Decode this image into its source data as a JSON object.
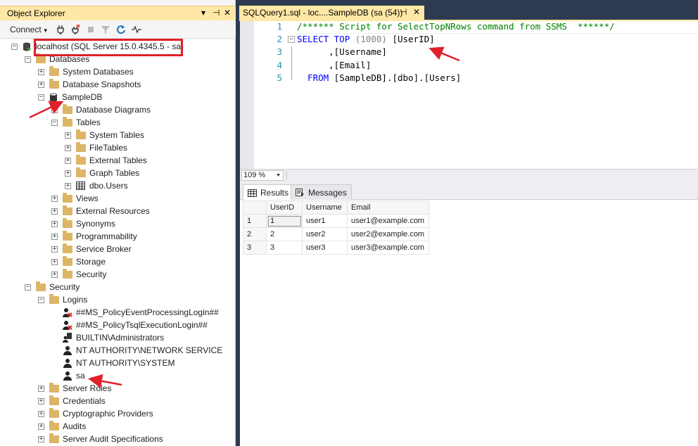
{
  "object_explorer": {
    "title": "Object Explorer",
    "pin": "▾ ‡",
    "close": "✕",
    "connect_label": "Connect",
    "tree": [
      {
        "label": "localhost (SQL Server 15.0.4345.5 - sa)",
        "icon": "server-icon",
        "expander": "−"
      },
      {
        "label": "Databases",
        "icon": "folder-icon",
        "expander": "−"
      },
      {
        "label": "System Databases",
        "icon": "folder-icon",
        "expander": "+"
      },
      {
        "label": "Database Snapshots",
        "icon": "folder-icon",
        "expander": "+"
      },
      {
        "label": "SampleDB",
        "icon": "database-icon",
        "expander": "−"
      },
      {
        "label": "Database Diagrams",
        "icon": "folder-icon",
        "expander": "+"
      },
      {
        "label": "Tables",
        "icon": "folder-icon",
        "expander": "−"
      },
      {
        "label": "System Tables",
        "icon": "folder-icon",
        "expander": "+"
      },
      {
        "label": "FileTables",
        "icon": "folder-icon",
        "expander": "+"
      },
      {
        "label": "External Tables",
        "icon": "folder-icon",
        "expander": "+"
      },
      {
        "label": "Graph Tables",
        "icon": "folder-icon",
        "expander": "+"
      },
      {
        "label": "dbo.Users",
        "icon": "table-icon",
        "expander": "+"
      },
      {
        "label": "Views",
        "icon": "folder-icon",
        "expander": "+"
      },
      {
        "label": "External Resources",
        "icon": "folder-icon",
        "expander": "+"
      },
      {
        "label": "Synonyms",
        "icon": "folder-icon",
        "expander": "+"
      },
      {
        "label": "Programmability",
        "icon": "folder-icon",
        "expander": "+"
      },
      {
        "label": "Service Broker",
        "icon": "folder-icon",
        "expander": "+"
      },
      {
        "label": "Storage",
        "icon": "folder-icon",
        "expander": "+"
      },
      {
        "label": "Security",
        "icon": "folder-icon",
        "expander": "+"
      },
      {
        "label": "Security",
        "icon": "folder-icon",
        "expander": "−"
      },
      {
        "label": "Logins",
        "icon": "folder-icon",
        "expander": "−"
      },
      {
        "label": "##MS_PolicyEventProcessingLogin##",
        "icon": "disabled-login-icon",
        "expander": ""
      },
      {
        "label": "##MS_PolicyTsqlExecutionLogin##",
        "icon": "disabled-login-icon",
        "expander": ""
      },
      {
        "label": "BUILTIN\\Administrators",
        "icon": "group-login-icon",
        "expander": ""
      },
      {
        "label": "NT AUTHORITY\\NETWORK SERVICE",
        "icon": "user-login-icon",
        "expander": ""
      },
      {
        "label": "NT AUTHORITY\\SYSTEM",
        "icon": "user-login-icon",
        "expander": ""
      },
      {
        "label": "sa",
        "icon": "user-login-icon",
        "expander": ""
      },
      {
        "label": "Server Roles",
        "icon": "folder-icon",
        "expander": "+"
      },
      {
        "label": "Credentials",
        "icon": "folder-icon",
        "expander": "+"
      },
      {
        "label": "Cryptographic Providers",
        "icon": "folder-icon",
        "expander": "+"
      },
      {
        "label": "Audits",
        "icon": "folder-icon",
        "expander": "+"
      },
      {
        "label": "Server Audit Specifications",
        "icon": "folder-icon",
        "expander": "+"
      }
    ]
  },
  "editor": {
    "tab_title": "SQLQuery1.sql - loc....SampleDB (sa (54))",
    "tab_pin": "⊣",
    "tab_close": "✕",
    "line_numbers": [
      "1",
      "2",
      "3",
      "4",
      "5"
    ],
    "lines": {
      "l1_comment": "/****** Script for SelectTopNRows command from SSMS  ******/",
      "l2_select": "SELECT",
      "l2_top": " TOP ",
      "l2_paren": "(1000)",
      "l2_col": " [UserID]",
      "l3": "      ,[Username]",
      "l4": "      ,[Email]",
      "l5_from": "  FROM",
      "l5_rest": " [SampleDB].[dbo].[Users]"
    },
    "zoom": "109 %"
  },
  "results": {
    "tabs": {
      "results": "Results",
      "messages": "Messages"
    },
    "columns": [
      "UserID",
      "Username",
      "Email"
    ],
    "rows": [
      {
        "n": "1",
        "UserID": "1",
        "Username": "user1",
        "Email": "user1@example.com"
      },
      {
        "n": "2",
        "UserID": "2",
        "Username": "user2",
        "Email": "user2@example.com"
      },
      {
        "n": "3",
        "UserID": "3",
        "Username": "user3",
        "Email": "user3@example.com"
      }
    ]
  },
  "colors": {
    "active_tab": "#ffe8a6",
    "annotation_red": "#e0202a",
    "keyword_blue": "#0000ff",
    "comment_green": "#008000"
  }
}
